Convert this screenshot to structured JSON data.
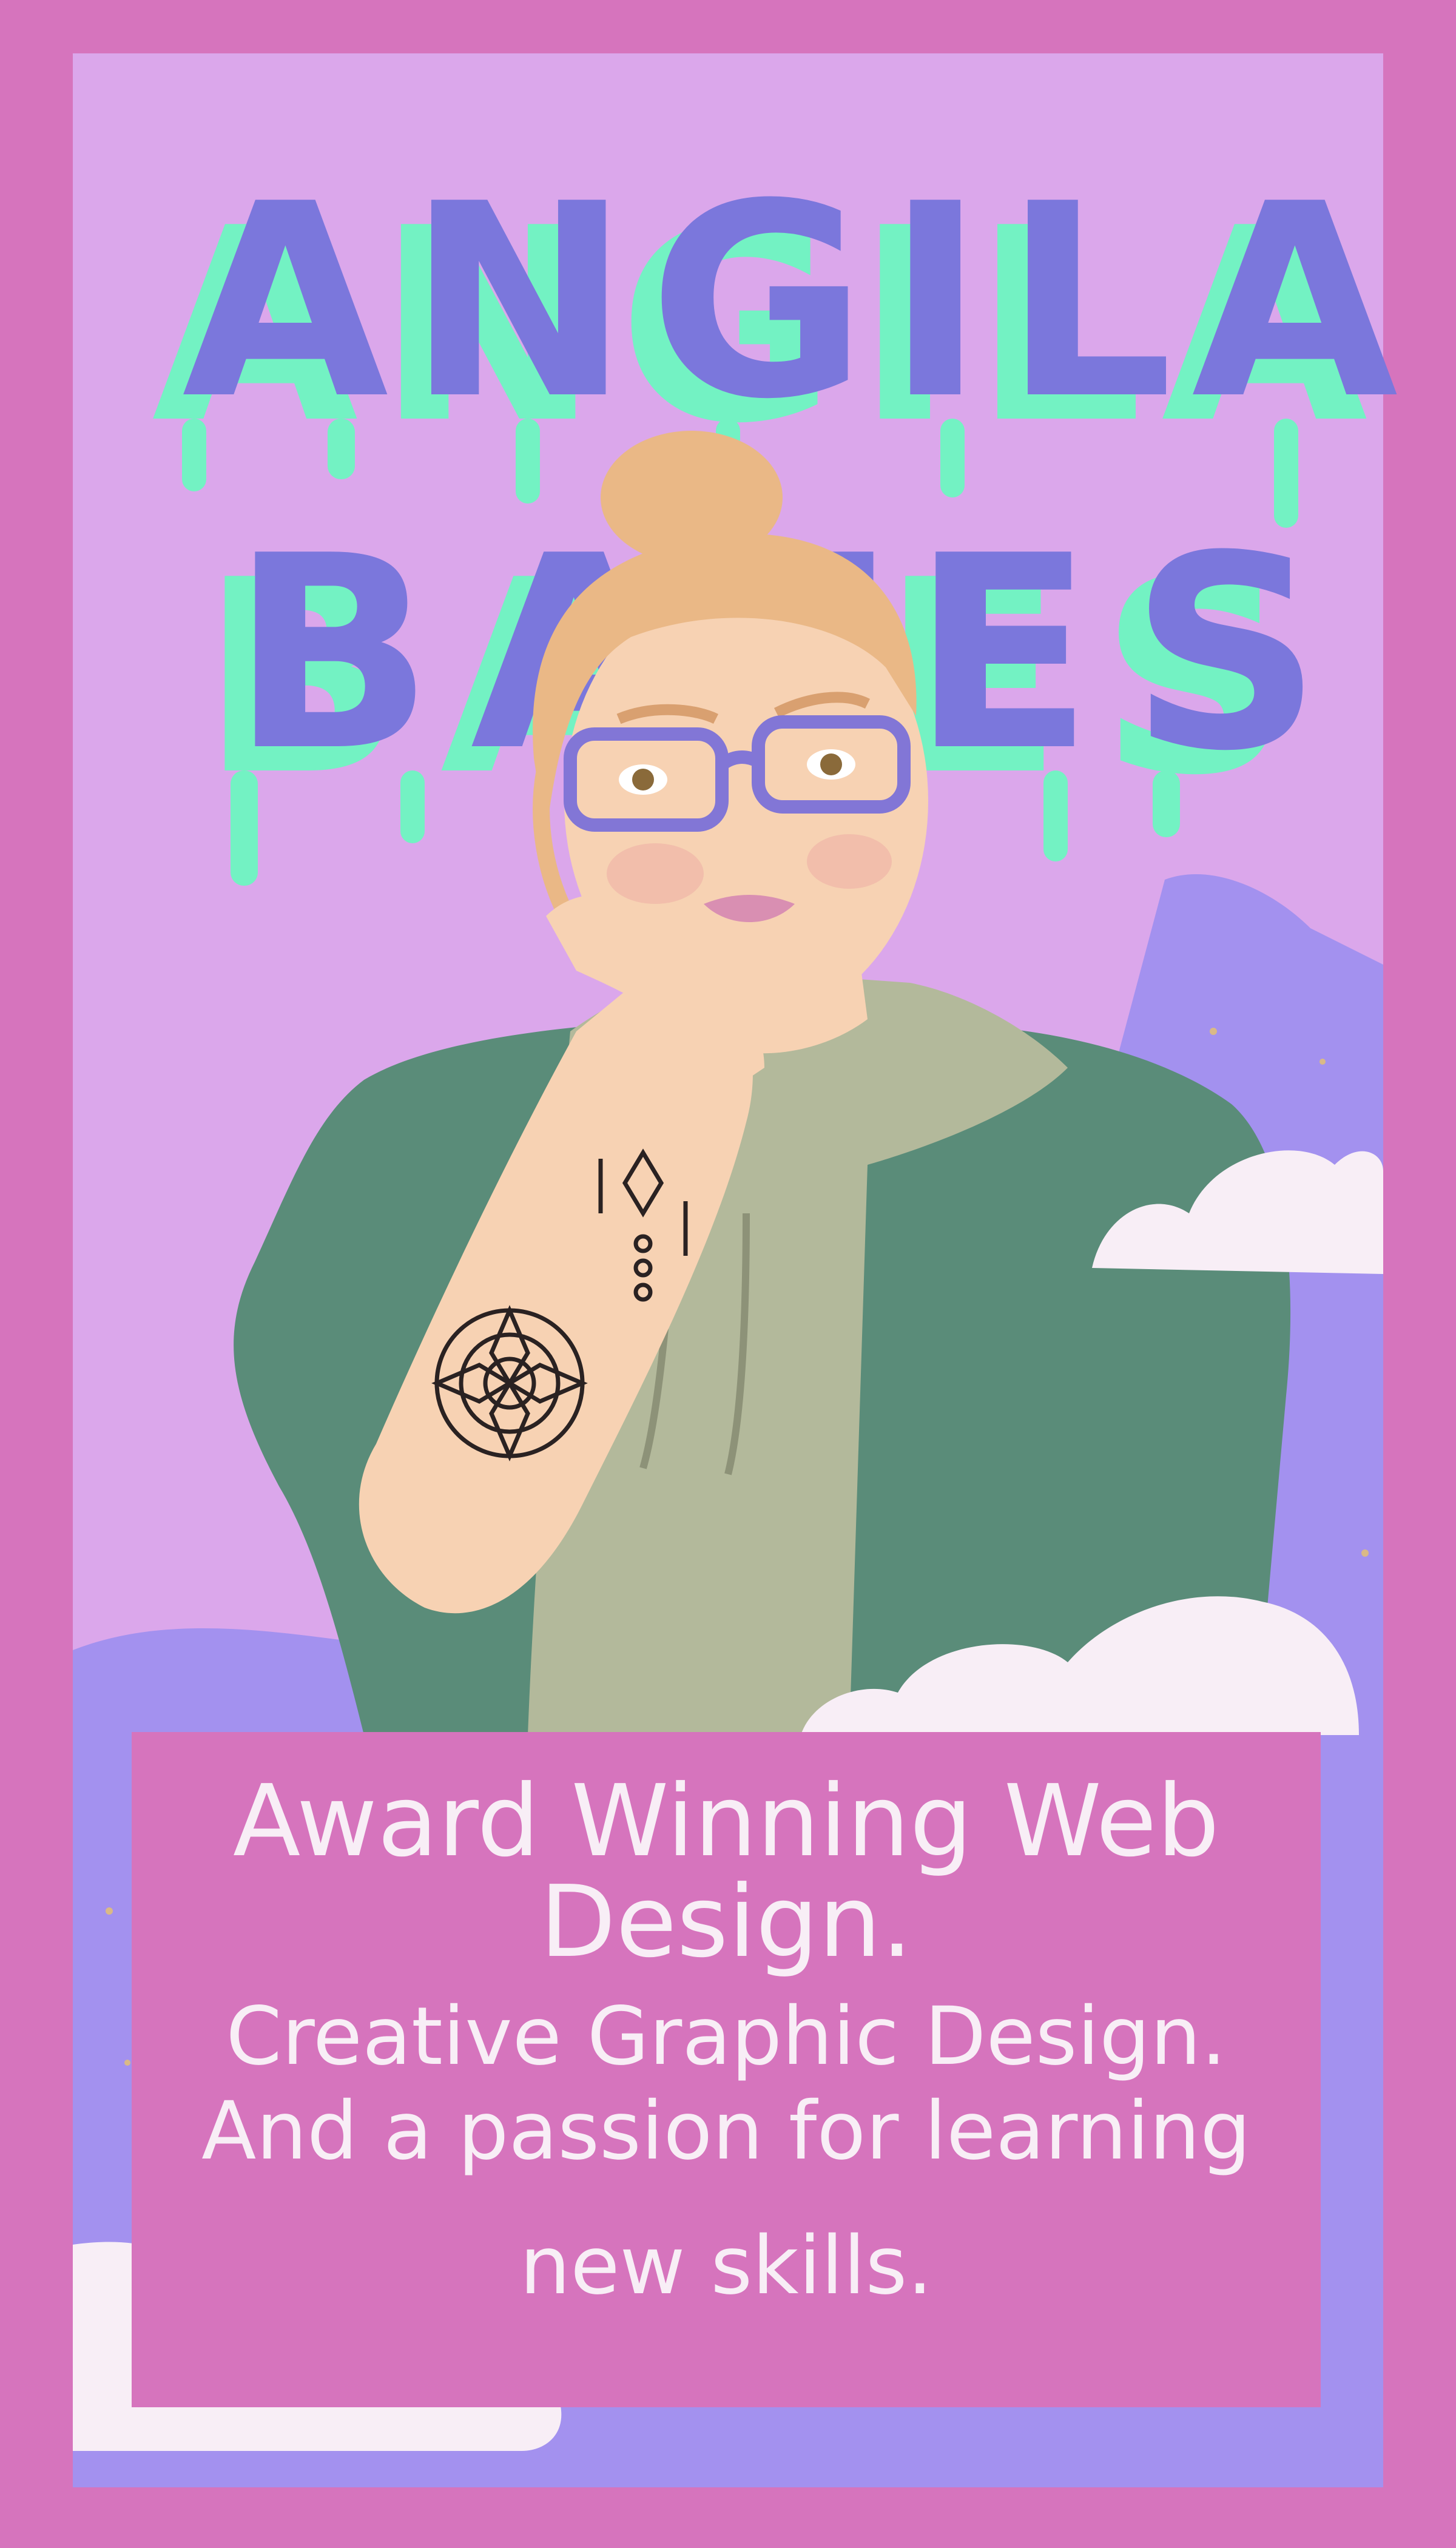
{
  "title": {
    "line1": "ANGILA",
    "line2": "BATES"
  },
  "caption": {
    "line1": "Award Winning Web Design.",
    "line2": "Creative Graphic Design.",
    "line3": "And a passion for learning",
    "line4": "new skills."
  },
  "colors": {
    "border": "#d674bd",
    "background": "#dba7eb",
    "hill": "#a391ef",
    "title_fill": "#7b77dc",
    "title_drip": "#73f2c3",
    "hoodie": "#5a8c79",
    "shirt": "#b3b99b",
    "skin": "#f7d2b3",
    "hair": "#eab886",
    "glasses": "#8276d6",
    "cloud": "#f8eef6",
    "caption_box": "#d674bd",
    "caption_text": "#f8eef6"
  }
}
